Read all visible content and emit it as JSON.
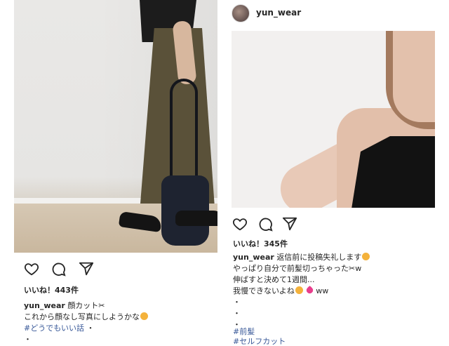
{
  "left_post": {
    "likes": "いいね！443件",
    "username": "yun_wear",
    "caption_line1": "顔カット✂",
    "caption_line2": "これから顔なし写真にしようかな",
    "hashtag": "#どうでもいい話",
    "dot1": "・",
    "dot2": "・"
  },
  "right_post": {
    "header_username": "yun_wear",
    "likes": "いいね！345件",
    "username": "yun_wear",
    "caption_line1": "返信前に投稿失礼します",
    "caption_line2": "やっぱり自分で前髪切っちゃった✂w",
    "caption_line3": "伸ばすと決めて1週間...",
    "caption_line4_a": "我慢できないよね",
    "caption_line4_b": "ww",
    "dot1": "・",
    "dot2": "・",
    "dot3": "・",
    "hashtag1": "#前髪",
    "hashtag2": "#セルフカット"
  },
  "icons": {
    "like": "heart-icon",
    "comment": "comment-icon",
    "share": "send-icon"
  }
}
